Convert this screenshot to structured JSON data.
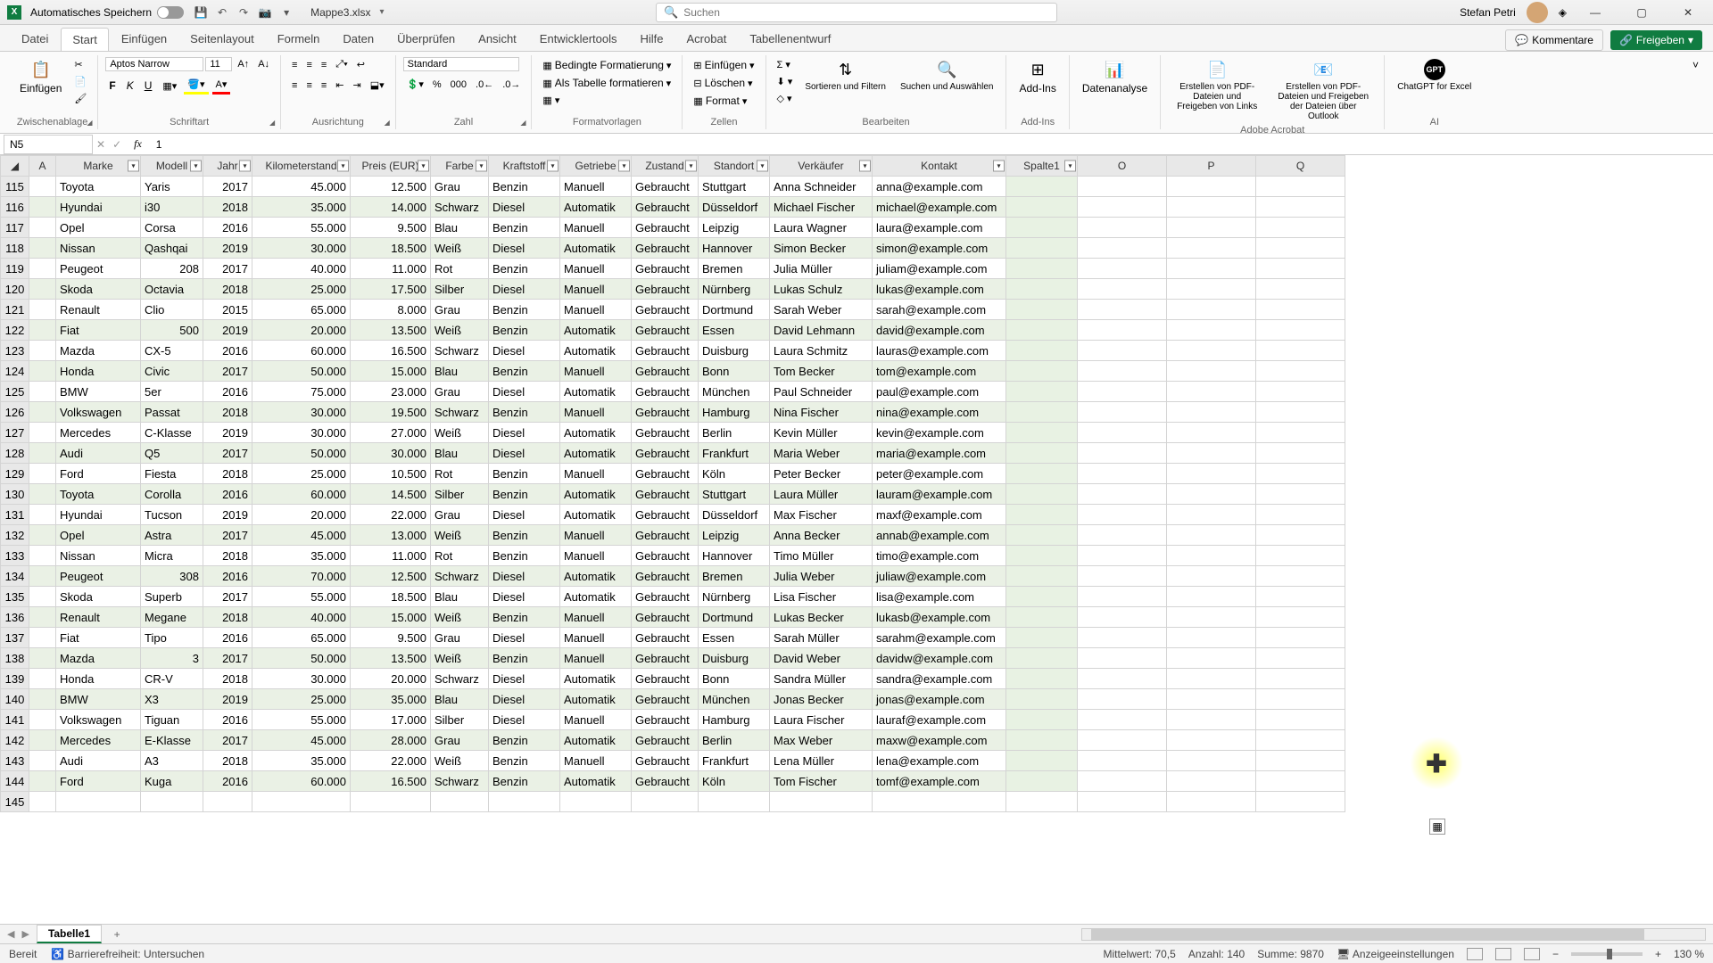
{
  "title": {
    "autosave": "Automatisches Speichern",
    "filename": "Mappe3.xlsx",
    "search_placeholder": "Suchen",
    "user": "Stefan Petri"
  },
  "tabs": {
    "items": [
      "Datei",
      "Start",
      "Einfügen",
      "Seitenlayout",
      "Formeln",
      "Daten",
      "Überprüfen",
      "Ansicht",
      "Entwicklertools",
      "Hilfe",
      "Acrobat",
      "Tabellenentwurf"
    ],
    "active_index": 1,
    "comments": "Kommentare",
    "share": "Freigeben"
  },
  "ribbon": {
    "paste": "Einfügen",
    "clipboard": "Zwischenablage",
    "font_name": "Aptos Narrow",
    "font_size": "11",
    "font_group": "Schriftart",
    "align_group": "Ausrichtung",
    "number_format": "Standard",
    "number_group": "Zahl",
    "cond_format": "Bedingte Formatierung",
    "as_table": "Als Tabelle formatieren",
    "styles_group": "Formatvorlagen",
    "insert": "Einfügen",
    "delete": "Löschen",
    "format": "Format",
    "cells_group": "Zellen",
    "sort": "Sortieren und Filtern",
    "find": "Suchen und Auswählen",
    "edit_group": "Bearbeiten",
    "addins": "Add-Ins",
    "addins_group": "Add-Ins",
    "data_analysis": "Datenanalyse",
    "pdf_create": "Erstellen von PDF-Dateien und Freigeben von Links",
    "pdf_outlook": "Erstellen von PDF-Dateien und Freigeben der Dateien über Outlook",
    "acrobat_group": "Adobe Acrobat",
    "gpt": "ChatGPT for Excel",
    "ai_group": "AI"
  },
  "namebox": "N5",
  "formula": "1",
  "columns": {
    "sys": [
      "A"
    ],
    "headers": [
      "Marke",
      "Modell",
      "Jahr",
      "Kilometerstand",
      "Preis (EUR)",
      "Farbe",
      "Kraftstoff",
      "Getriebe",
      "Zustand",
      "Standort",
      "Verkäufer",
      "Kontakt",
      "Spalte1"
    ],
    "extra": [
      "O",
      "P",
      "Q"
    ]
  },
  "chart_data": {
    "type": "table",
    "first_row_number": 115,
    "columns": [
      "Marke",
      "Modell",
      "Jahr",
      "Kilometerstand",
      "Preis (EUR)",
      "Farbe",
      "Kraftstoff",
      "Getriebe",
      "Zustand",
      "Standort",
      "Verkäufer",
      "Kontakt"
    ],
    "rows": [
      [
        "Toyota",
        "Yaris",
        "2017",
        "45.000",
        "12.500",
        "Grau",
        "Benzin",
        "Manuell",
        "Gebraucht",
        "Stuttgart",
        "Anna Schneider",
        "anna@example.com"
      ],
      [
        "Hyundai",
        "i30",
        "2018",
        "35.000",
        "14.000",
        "Schwarz",
        "Diesel",
        "Automatik",
        "Gebraucht",
        "Düsseldorf",
        "Michael Fischer",
        "michael@example.com"
      ],
      [
        "Opel",
        "Corsa",
        "2016",
        "55.000",
        "9.500",
        "Blau",
        "Benzin",
        "Manuell",
        "Gebraucht",
        "Leipzig",
        "Laura Wagner",
        "laura@example.com"
      ],
      [
        "Nissan",
        "Qashqai",
        "2019",
        "30.000",
        "18.500",
        "Weiß",
        "Diesel",
        "Automatik",
        "Gebraucht",
        "Hannover",
        "Simon Becker",
        "simon@example.com"
      ],
      [
        "Peugeot",
        "208",
        "2017",
        "40.000",
        "11.000",
        "Rot",
        "Benzin",
        "Manuell",
        "Gebraucht",
        "Bremen",
        "Julia Müller",
        "juliam@example.com"
      ],
      [
        "Skoda",
        "Octavia",
        "2018",
        "25.000",
        "17.500",
        "Silber",
        "Diesel",
        "Manuell",
        "Gebraucht",
        "Nürnberg",
        "Lukas Schulz",
        "lukas@example.com"
      ],
      [
        "Renault",
        "Clio",
        "2015",
        "65.000",
        "8.000",
        "Grau",
        "Benzin",
        "Manuell",
        "Gebraucht",
        "Dortmund",
        "Sarah Weber",
        "sarah@example.com"
      ],
      [
        "Fiat",
        "500",
        "2019",
        "20.000",
        "13.500",
        "Weiß",
        "Benzin",
        "Automatik",
        "Gebraucht",
        "Essen",
        "David Lehmann",
        "david@example.com"
      ],
      [
        "Mazda",
        "CX-5",
        "2016",
        "60.000",
        "16.500",
        "Schwarz",
        "Diesel",
        "Automatik",
        "Gebraucht",
        "Duisburg",
        "Laura Schmitz",
        "lauras@example.com"
      ],
      [
        "Honda",
        "Civic",
        "2017",
        "50.000",
        "15.000",
        "Blau",
        "Benzin",
        "Manuell",
        "Gebraucht",
        "Bonn",
        "Tom Becker",
        "tom@example.com"
      ],
      [
        "BMW",
        "5er",
        "2016",
        "75.000",
        "23.000",
        "Grau",
        "Diesel",
        "Automatik",
        "Gebraucht",
        "München",
        "Paul Schneider",
        "paul@example.com"
      ],
      [
        "Volkswagen",
        "Passat",
        "2018",
        "30.000",
        "19.500",
        "Schwarz",
        "Benzin",
        "Manuell",
        "Gebraucht",
        "Hamburg",
        "Nina Fischer",
        "nina@example.com"
      ],
      [
        "Mercedes",
        "C-Klasse",
        "2019",
        "30.000",
        "27.000",
        "Weiß",
        "Diesel",
        "Automatik",
        "Gebraucht",
        "Berlin",
        "Kevin Müller",
        "kevin@example.com"
      ],
      [
        "Audi",
        "Q5",
        "2017",
        "50.000",
        "30.000",
        "Blau",
        "Diesel",
        "Automatik",
        "Gebraucht",
        "Frankfurt",
        "Maria Weber",
        "maria@example.com"
      ],
      [
        "Ford",
        "Fiesta",
        "2018",
        "25.000",
        "10.500",
        "Rot",
        "Benzin",
        "Manuell",
        "Gebraucht",
        "Köln",
        "Peter Becker",
        "peter@example.com"
      ],
      [
        "Toyota",
        "Corolla",
        "2016",
        "60.000",
        "14.500",
        "Silber",
        "Benzin",
        "Automatik",
        "Gebraucht",
        "Stuttgart",
        "Laura Müller",
        "lauram@example.com"
      ],
      [
        "Hyundai",
        "Tucson",
        "2019",
        "20.000",
        "22.000",
        "Grau",
        "Diesel",
        "Automatik",
        "Gebraucht",
        "Düsseldorf",
        "Max Fischer",
        "maxf@example.com"
      ],
      [
        "Opel",
        "Astra",
        "2017",
        "45.000",
        "13.000",
        "Weiß",
        "Benzin",
        "Manuell",
        "Gebraucht",
        "Leipzig",
        "Anna Becker",
        "annab@example.com"
      ],
      [
        "Nissan",
        "Micra",
        "2018",
        "35.000",
        "11.000",
        "Rot",
        "Benzin",
        "Manuell",
        "Gebraucht",
        "Hannover",
        "Timo Müller",
        "timo@example.com"
      ],
      [
        "Peugeot",
        "308",
        "2016",
        "70.000",
        "12.500",
        "Schwarz",
        "Diesel",
        "Automatik",
        "Gebraucht",
        "Bremen",
        "Julia Weber",
        "juliaw@example.com"
      ],
      [
        "Skoda",
        "Superb",
        "2017",
        "55.000",
        "18.500",
        "Blau",
        "Diesel",
        "Automatik",
        "Gebraucht",
        "Nürnberg",
        "Lisa Fischer",
        "lisa@example.com"
      ],
      [
        "Renault",
        "Megane",
        "2018",
        "40.000",
        "15.000",
        "Weiß",
        "Benzin",
        "Manuell",
        "Gebraucht",
        "Dortmund",
        "Lukas Becker",
        "lukasb@example.com"
      ],
      [
        "Fiat",
        "Tipo",
        "2016",
        "65.000",
        "9.500",
        "Grau",
        "Diesel",
        "Manuell",
        "Gebraucht",
        "Essen",
        "Sarah Müller",
        "sarahm@example.com"
      ],
      [
        "Mazda",
        "3",
        "2017",
        "50.000",
        "13.500",
        "Weiß",
        "Benzin",
        "Manuell",
        "Gebraucht",
        "Duisburg",
        "David Weber",
        "davidw@example.com"
      ],
      [
        "Honda",
        "CR-V",
        "2018",
        "30.000",
        "20.000",
        "Schwarz",
        "Diesel",
        "Automatik",
        "Gebraucht",
        "Bonn",
        "Sandra Müller",
        "sandra@example.com"
      ],
      [
        "BMW",
        "X3",
        "2019",
        "25.000",
        "35.000",
        "Blau",
        "Diesel",
        "Automatik",
        "Gebraucht",
        "München",
        "Jonas Becker",
        "jonas@example.com"
      ],
      [
        "Volkswagen",
        "Tiguan",
        "2016",
        "55.000",
        "17.000",
        "Silber",
        "Diesel",
        "Manuell",
        "Gebraucht",
        "Hamburg",
        "Laura Fischer",
        "lauraf@example.com"
      ],
      [
        "Mercedes",
        "E-Klasse",
        "2017",
        "45.000",
        "28.000",
        "Grau",
        "Benzin",
        "Automatik",
        "Gebraucht",
        "Berlin",
        "Max Weber",
        "maxw@example.com"
      ],
      [
        "Audi",
        "A3",
        "2018",
        "35.000",
        "22.000",
        "Weiß",
        "Benzin",
        "Manuell",
        "Gebraucht",
        "Frankfurt",
        "Lena Müller",
        "lena@example.com"
      ],
      [
        "Ford",
        "Kuga",
        "2016",
        "60.000",
        "16.500",
        "Schwarz",
        "Benzin",
        "Automatik",
        "Gebraucht",
        "Köln",
        "Tom Fischer",
        "tomf@example.com"
      ]
    ]
  },
  "sheets": {
    "active": "Tabelle1"
  },
  "statusbar": {
    "ready": "Bereit",
    "accessibility": "Barrierefreiheit: Untersuchen",
    "avg": "Mittelwert: 70,5",
    "count": "Anzahl: 140",
    "sum": "Summe: 9870",
    "display": "Anzeigeeinstellungen",
    "zoom": "130 %"
  }
}
